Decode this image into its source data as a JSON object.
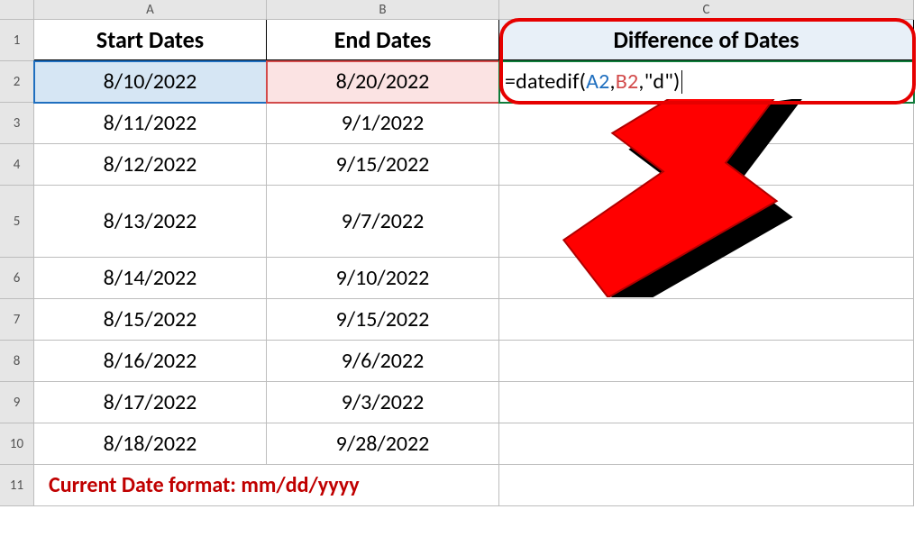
{
  "columns": {
    "A": "A",
    "B": "B",
    "C": "C"
  },
  "rowHeaders": {
    "1": "1",
    "2": "2",
    "3": "3",
    "4": "4",
    "5": "5",
    "6": "6",
    "7": "7",
    "8": "8",
    "9": "9",
    "10": "10",
    "11": "11"
  },
  "headers": {
    "start": "Start Dates",
    "end": "End Dates",
    "diff": "Difference of Dates"
  },
  "data": {
    "start": [
      "8/10/2022",
      "8/11/2022",
      "8/12/2022",
      "8/13/2022",
      "8/14/2022",
      "8/15/2022",
      "8/16/2022",
      "8/17/2022",
      "8/18/2022"
    ],
    "end": [
      "8/20/2022",
      "9/1/2022",
      "9/15/2022",
      "9/7/2022",
      "9/10/2022",
      "9/15/2022",
      "9/6/2022",
      "9/3/2022",
      "9/28/2022"
    ]
  },
  "formula": {
    "prefix": "=datedif(",
    "ref1": "A2",
    "comma1": ",",
    "ref2": "B2",
    "comma2": ",",
    "arg": "\"d\"",
    "suffix": ")"
  },
  "note": "Current Date format: mm/dd/yyyy"
}
